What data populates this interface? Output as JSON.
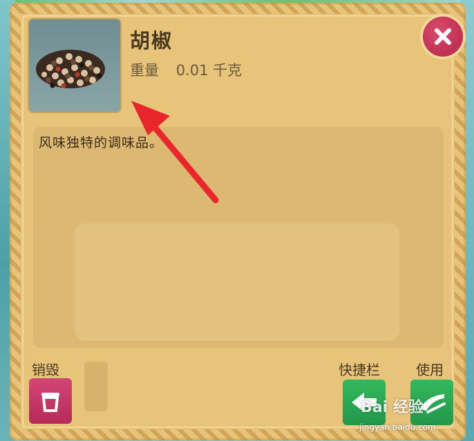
{
  "item": {
    "name": "胡椒",
    "weight_label": "重量",
    "weight_value": "0.01 千克",
    "description": "风味独特的调味品。",
    "thumbnail_icon": "pepper-pile-icon"
  },
  "actions": {
    "destroy_label": "销毁",
    "quickbar_label": "快捷栏",
    "use_label": "使用"
  },
  "watermark": {
    "text": "Bai 经验",
    "url": "jingyan.baidu.com"
  },
  "colors": {
    "panel": "#e8c37a",
    "close": "#c8345a",
    "destroy": "#c93a69",
    "green": "#2aa854",
    "arrow": "#e8262c"
  }
}
